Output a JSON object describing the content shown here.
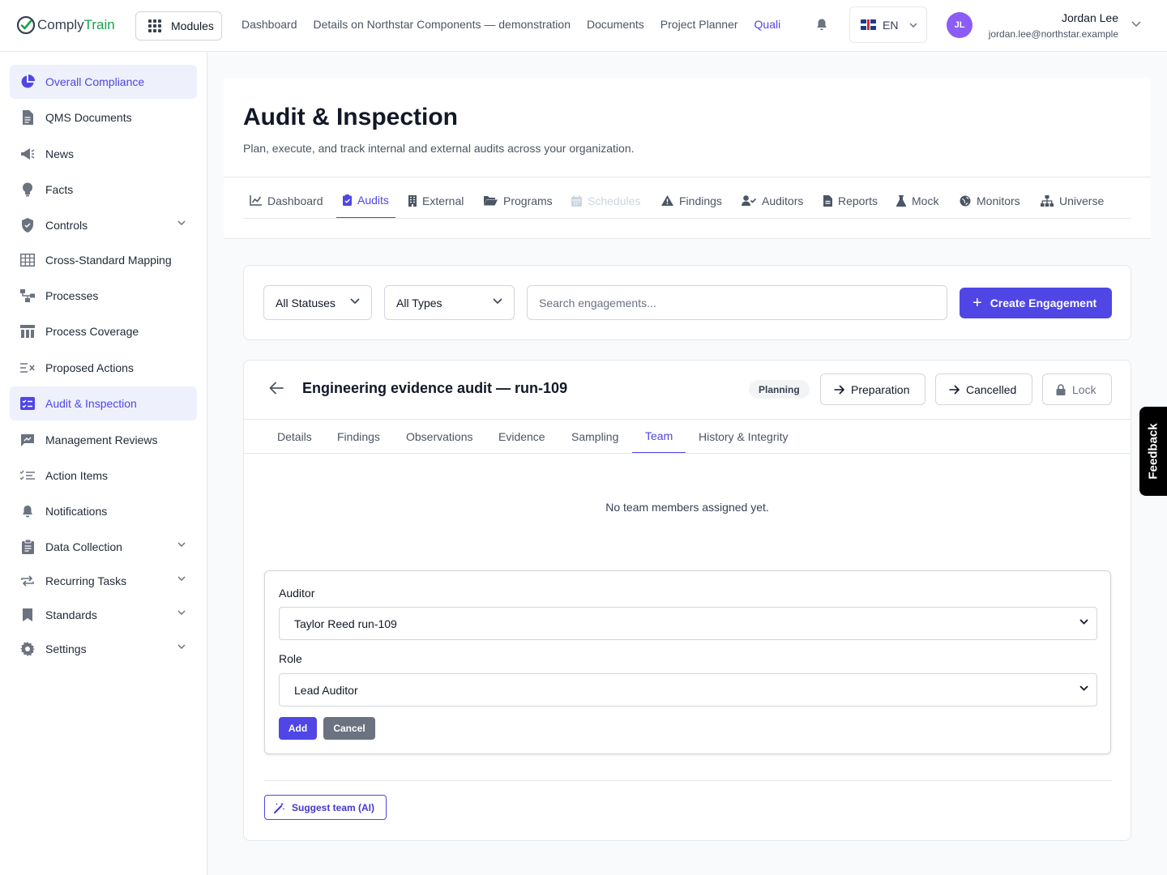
{
  "brand": {
    "name_part1": "Comply",
    "name_part2": "Train",
    "accent": "#16a34a"
  },
  "topbar": {
    "modules_label": "Modules",
    "nav": [
      "Dashboard",
      "Details on Northstar Components — demonstration",
      "Documents",
      "Project Planner",
      "Quali"
    ],
    "active_nav": "Quali",
    "language": "EN",
    "user": {
      "initials": "JL",
      "name": "Jordan Lee",
      "email": "jordan.lee@northstar.example"
    }
  },
  "sidebar": {
    "items": [
      {
        "label": "Overall Compliance",
        "icon": "pie-chart-icon",
        "active": true
      },
      {
        "label": "QMS Documents",
        "icon": "document-icon"
      },
      {
        "label": "News",
        "icon": "megaphone-icon"
      },
      {
        "label": "Facts",
        "icon": "lightbulb-icon"
      },
      {
        "label": "Controls",
        "icon": "shield-icon",
        "expandable": true
      },
      {
        "label": "Cross-Standard Mapping",
        "icon": "table-icon"
      },
      {
        "label": "Processes",
        "icon": "flow-icon"
      },
      {
        "label": "Process Coverage",
        "icon": "coverage-icon"
      },
      {
        "label": "Proposed Actions",
        "icon": "list-x-icon"
      },
      {
        "label": "Audit & Inspection",
        "icon": "audit-icon",
        "active": true
      },
      {
        "label": "Management Reviews",
        "icon": "review-icon"
      },
      {
        "label": "Action Items",
        "icon": "checklist-icon"
      },
      {
        "label": "Notifications",
        "icon": "bell-icon"
      },
      {
        "label": "Data Collection",
        "icon": "clipboard-icon",
        "expandable": true
      },
      {
        "label": "Recurring Tasks",
        "icon": "repeat-icon",
        "expandable": true
      },
      {
        "label": "Standards",
        "icon": "bookmark-icon",
        "expandable": true
      },
      {
        "label": "Settings",
        "icon": "gear-icon",
        "expandable": true
      }
    ]
  },
  "page": {
    "title": "Audit & Inspection",
    "subtitle": "Plan, execute, and track internal and external audits across your organization.",
    "tabs": [
      {
        "label": "Dashboard",
        "icon": "chart-line-icon"
      },
      {
        "label": "Audits",
        "icon": "clipboard-check-icon",
        "active": true
      },
      {
        "label": "External",
        "icon": "building-icon"
      },
      {
        "label": "Programs",
        "icon": "folder-open-icon"
      },
      {
        "label": "Schedules",
        "icon": "calendar-icon",
        "disabled": true
      },
      {
        "label": "Findings",
        "icon": "warning-icon"
      },
      {
        "label": "Auditors",
        "icon": "user-check-icon"
      },
      {
        "label": "Reports",
        "icon": "file-icon"
      },
      {
        "label": "Mock",
        "icon": "flask-icon"
      },
      {
        "label": "Monitors",
        "icon": "globe-icon"
      },
      {
        "label": "Universe",
        "icon": "sitemap-icon"
      }
    ]
  },
  "filters": {
    "status": "All Statuses",
    "type": "All Types",
    "search_placeholder": "Search engagements...",
    "create_label": "Create Engagement"
  },
  "engagement": {
    "title": "Engineering evidence audit — run-109",
    "status": "Planning",
    "actions": [
      "Preparation",
      "Cancelled",
      "Lock"
    ],
    "tabs": [
      "Details",
      "Findings",
      "Observations",
      "Evidence",
      "Sampling",
      "Team",
      "History & Integrity"
    ],
    "active_tab": "Team",
    "empty_message": "No team members assigned yet.",
    "form": {
      "auditor_label": "Auditor",
      "auditor_value": "Taylor Reed run-109",
      "role_label": "Role",
      "role_value": "Lead Auditor",
      "add_label": "Add",
      "cancel_label": "Cancel"
    },
    "suggest_label": "Suggest team (AI)"
  },
  "feedback_label": "Feedback",
  "colors": {
    "primary": "#4f46e5",
    "active_bg": "#eef0fc",
    "badge_bg": "#f3f4f6"
  }
}
